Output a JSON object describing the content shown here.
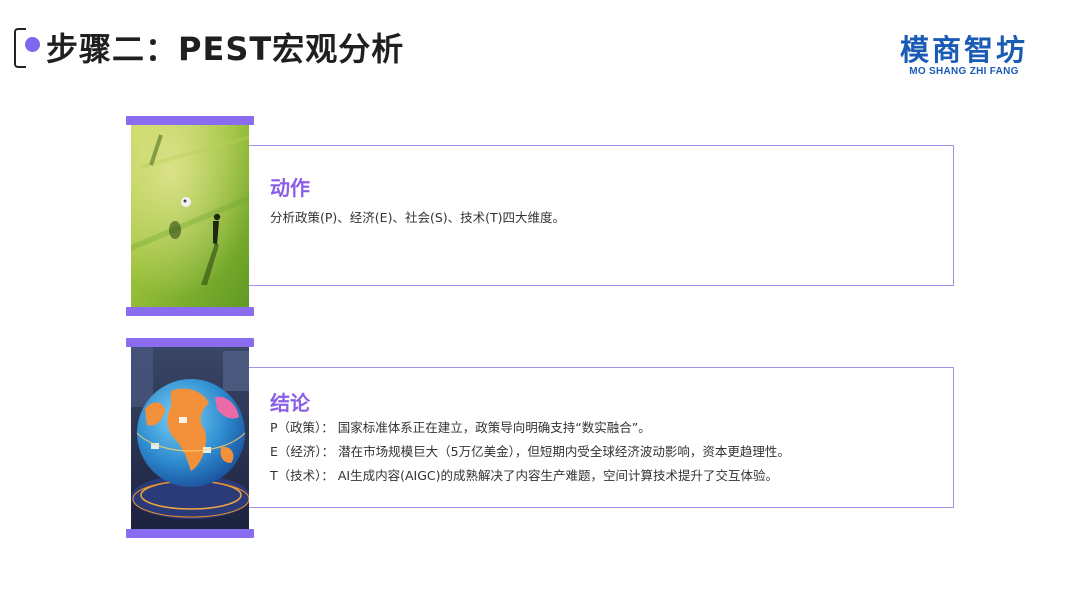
{
  "header": {
    "title": "步骤二：PEST宏观分析",
    "accent_color": "#7b68ee"
  },
  "logo": {
    "cn": "模商智坊",
    "en": "MO SHANG ZHI FANG",
    "color": "#1a5bb5"
  },
  "cards": [
    {
      "heading": "动作",
      "image_icon": "soccer-field-image",
      "lines": [
        "分析政策(P)、经济(E)、社会(S)、技术(T)四大维度。"
      ]
    },
    {
      "heading": "结论",
      "image_icon": "globe-image",
      "lines": [
        "P（政策）： 国家标准体系正在建立，政策导向明确支持“数实融合”。",
        "E（经济）： 潜在市场规模巨大（5万亿美金），但短期内受全球经济波动影响，资本更趋理性。",
        "T（技术）： AI生成内容(AIGC)的成熟解决了内容生产难题，空间计算技术提升了交互体验。"
      ]
    }
  ],
  "colors": {
    "card_border": "#9d94ec",
    "bar": "#8a6cf0",
    "heading": "#8a5ee8"
  }
}
